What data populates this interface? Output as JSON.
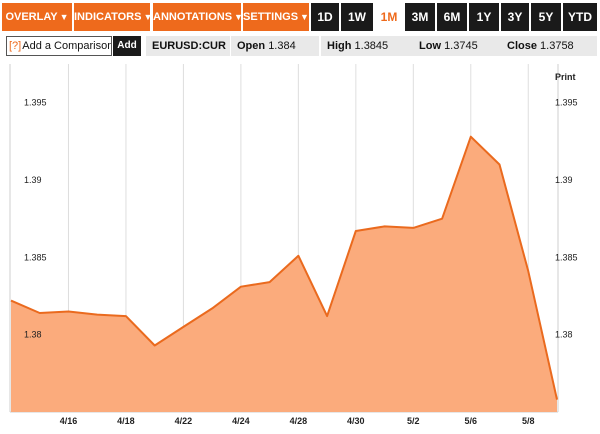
{
  "toolbar": {
    "menus": [
      {
        "label": "OVERLAY"
      },
      {
        "label": "INDICATORS"
      },
      {
        "label": "ANNOTATIONS"
      },
      {
        "label": "SETTINGS"
      }
    ],
    "ranges": [
      {
        "label": "1D",
        "active": false
      },
      {
        "label": "1W",
        "active": false
      },
      {
        "label": "1M",
        "active": true
      },
      {
        "label": "3M",
        "active": false
      },
      {
        "label": "6M",
        "active": false
      },
      {
        "label": "1Y",
        "active": false
      },
      {
        "label": "3Y",
        "active": false
      },
      {
        "label": "5Y",
        "active": false
      },
      {
        "label": "YTD",
        "active": false
      }
    ]
  },
  "compare": {
    "help": "[?]",
    "label": "Add a Comparison",
    "add_label": "Add"
  },
  "quote": {
    "symbol": "EURUSD:CUR",
    "open_label": "Open",
    "open_value": "1.384",
    "high_label": "High",
    "high_value": "1.3845",
    "low_label": "Low",
    "low_value": "1.3745",
    "close_label": "Close",
    "close_value": "1.3758"
  },
  "print_label": "Print",
  "colors": {
    "accent": "#ee6a1c",
    "fill": "#fbab7c",
    "line": "#ea6a1e"
  },
  "chart_data": {
    "type": "area",
    "x": [
      "4/14",
      "4/15",
      "4/16",
      "4/17",
      "4/18",
      "4/21",
      "4/22",
      "4/23",
      "4/24",
      "4/25",
      "4/28",
      "4/29",
      "4/30",
      "5/1",
      "5/2",
      "5/5",
      "5/6",
      "5/7",
      "5/8",
      "5/9"
    ],
    "values": [
      1.3822,
      1.3814,
      1.3815,
      1.3813,
      1.3812,
      1.3793,
      1.3805,
      1.3817,
      1.3831,
      1.3834,
      1.3851,
      1.3812,
      1.3867,
      1.387,
      1.3869,
      1.3875,
      1.3928,
      1.391,
      1.3841,
      1.3758
    ],
    "xticks": [
      "4/16",
      "4/18",
      "4/22",
      "4/24",
      "4/28",
      "4/30",
      "5/2",
      "5/6",
      "5/8"
    ],
    "yticks": [
      "1.38",
      "1.385",
      "1.39",
      "1.395"
    ],
    "ylim": [
      1.375,
      1.3975
    ],
    "grid": "vertical"
  }
}
